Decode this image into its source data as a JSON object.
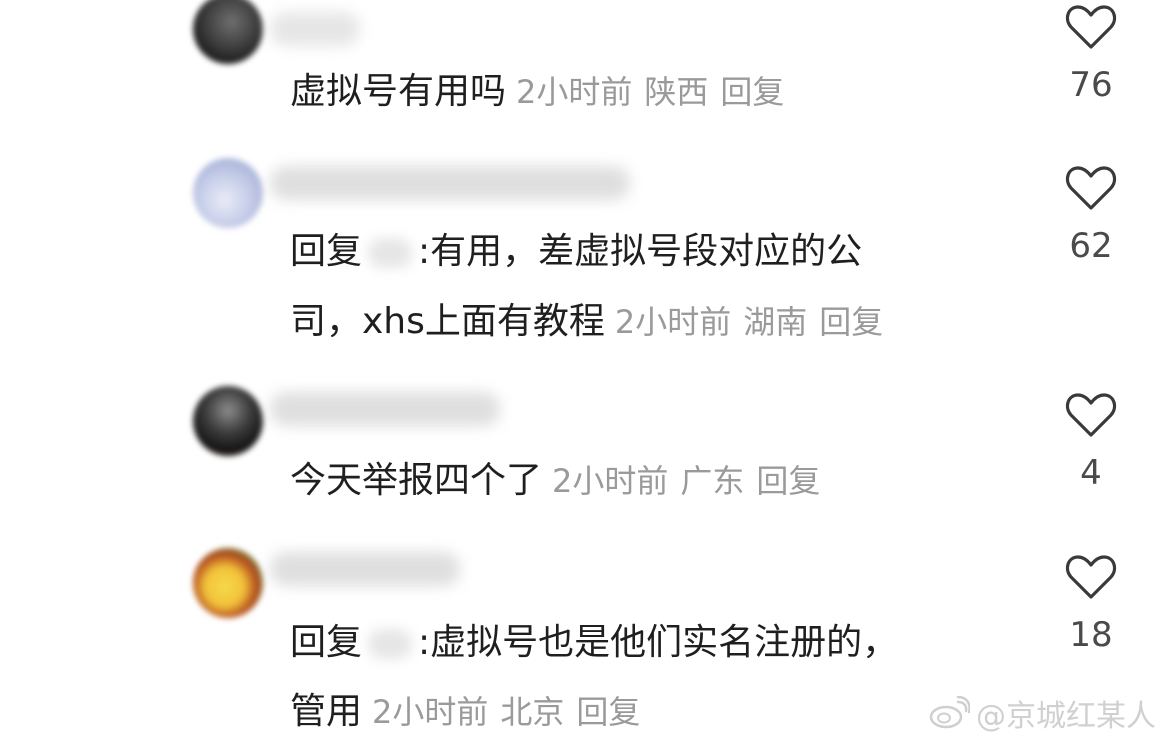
{
  "comments": [
    {
      "text": "虚拟号有用吗",
      "time": "2小时前",
      "location": "陕西",
      "reply_label": "回复",
      "likes": "76"
    },
    {
      "prefix": "回复",
      "line1": ":有用，差虚拟号段对应的公",
      "line2": "司，xhs上面有教程",
      "time": "2小时前",
      "location": "湖南",
      "reply_label": "回复",
      "likes": "62"
    },
    {
      "text": "今天举报四个了",
      "time": "2小时前",
      "location": "广东",
      "reply_label": "回复",
      "likes": "4"
    },
    {
      "prefix": "回复",
      "line1": ":虚拟号也是他们实名注册的，",
      "line2": "管用",
      "time": "2小时前",
      "location": "北京",
      "reply_label": "回复",
      "likes": "18"
    }
  ],
  "watermark": "@京城红某人",
  "icons": {
    "like": "heart-outline-icon",
    "watermark": "weibo-logo-icon"
  },
  "colors": {
    "text": "#1f1f1f",
    "meta": "#9a9a9a",
    "like_count": "#4a4a4a",
    "watermark": "#d0d0d0"
  }
}
